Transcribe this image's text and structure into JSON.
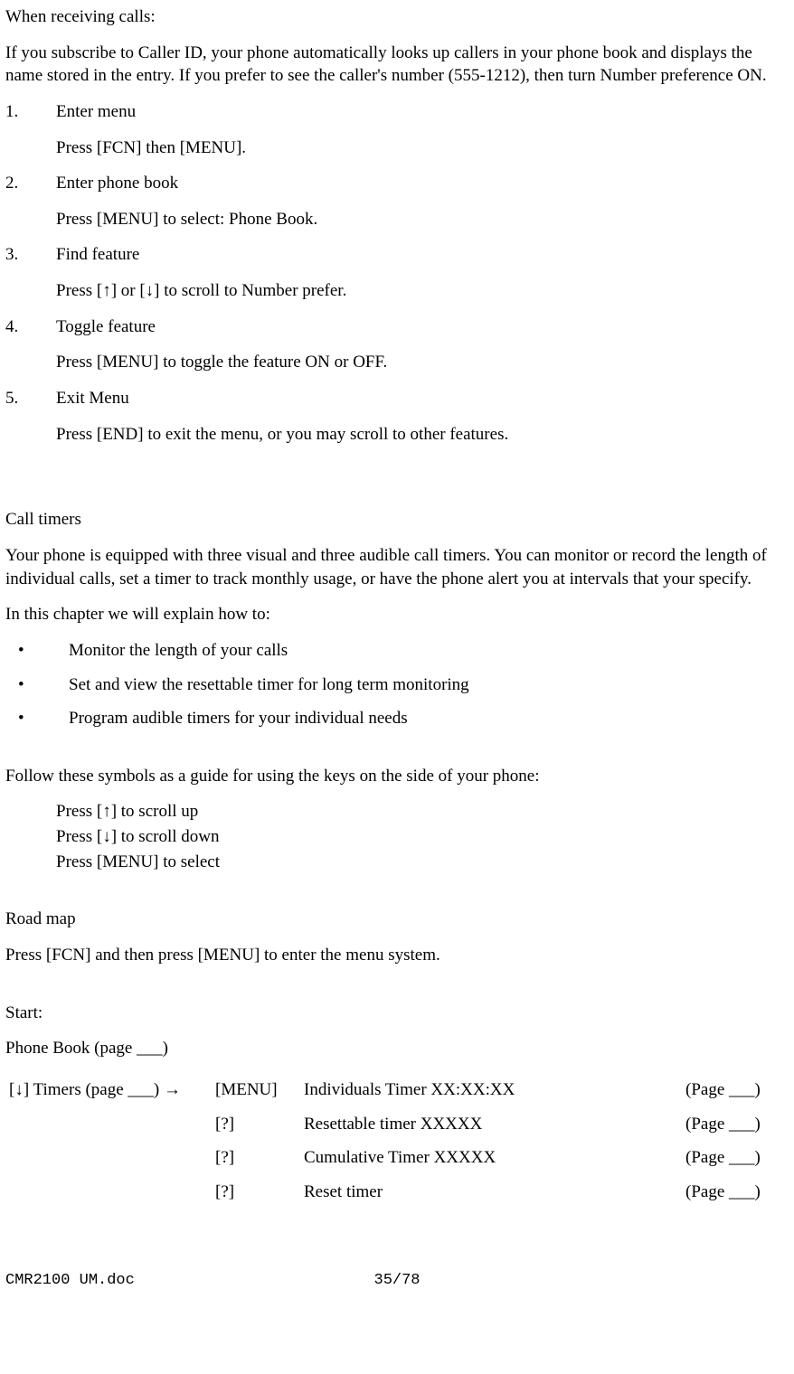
{
  "section1": {
    "title": "When receiving calls:",
    "intro": "If you subscribe to Caller ID, your phone  automatically looks up callers in your phone book and displays the name stored in the entry. If you prefer to see the caller's number (555-1212), then turn Number preference ON.",
    "steps": [
      {
        "num": "1.",
        "title": "Enter menu",
        "desc": "Press [FCN] then [MENU]."
      },
      {
        "num": "2.",
        "title": "Enter phone book",
        "desc": "Press [MENU] to select: Phone Book."
      },
      {
        "num": "3.",
        "title": "Find feature",
        "desc": "Press [↑] or [↓] to scroll to Number prefer."
      },
      {
        "num": "4.",
        "title": "Toggle feature",
        "desc": "Press [MENU] to toggle the feature ON or OFF."
      },
      {
        "num": "5.",
        "title": "Exit Menu",
        "desc": "Press [END] to exit the menu, or you may scroll to other features."
      }
    ]
  },
  "section2": {
    "title": "Call timers",
    "intro": "Your phone is equipped with three visual and three audible call timers. You can monitor or record the length of individual calls, set a timer to track monthly usage, or have the phone alert you at intervals that your specify.",
    "explain_intro": "In this chapter we will explain how to:",
    "bullets": [
      "Monitor the length of your calls",
      "Set and view the resettable timer for long term monitoring",
      "Program audible timers for your individual needs"
    ],
    "symbols_intro": "Follow these symbols as a guide for using the keys on the side of your phone:",
    "symbol_lines": [
      "Press [↑] to scroll up",
      "Press [↓] to scroll down",
      "Press [MENU] to select"
    ]
  },
  "roadmap": {
    "title": "Road map",
    "intro": "Press [FCN] and then press [MENU] to enter the menu system.",
    "start_label": "Start:",
    "phonebook": "Phone Book (page ___)",
    "nav": "[↓] Timers (page ___) →",
    "rows": [
      {
        "key": "[MENU]",
        "item": "Individuals Timer XX:XX:XX",
        "page": "(Page ___)"
      },
      {
        "key": "[?]",
        "item": "Resettable timer XXXXX",
        "page": "(Page ___)"
      },
      {
        "key": "[?]",
        "item": "Cumulative Timer XXXXX",
        "page": "(Page ___)"
      },
      {
        "key": "[?]",
        "item": "Reset timer",
        "page": "(Page ___)"
      }
    ]
  },
  "footer": {
    "left": "CMR2100 UM.doc",
    "center": "35/78"
  }
}
